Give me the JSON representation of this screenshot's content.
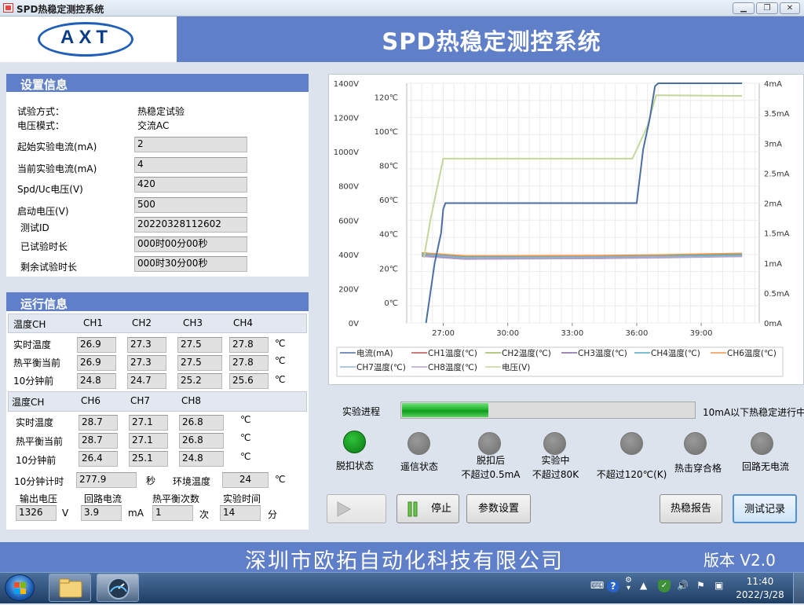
{
  "window": {
    "title": "SPD热稳定测控系统"
  },
  "header": {
    "logo_text": "AXT",
    "system_title": "SPD热稳定测控系统"
  },
  "settings": {
    "heading": "设置信息",
    "test_method_label": "试验方式：",
    "test_method_value": "热稳定试验",
    "voltage_mode_label": "电压模式：",
    "voltage_mode_value": "交流AC",
    "fields": [
      {
        "label": "起始实验电流(mA)",
        "value": "2"
      },
      {
        "label": "当前实验电流(mA)",
        "value": "4"
      },
      {
        "label": "Spd/Uc电压(V)",
        "value": "420"
      },
      {
        "label": "启动电压(V)",
        "value": "500"
      },
      {
        "label": "测试ID",
        "value": "20220328112602"
      },
      {
        "label": "已试验时长",
        "value": "000时00分00秒"
      },
      {
        "label": "剩余试验时长",
        "value": "000时30分00秒"
      }
    ]
  },
  "run": {
    "heading": "运行信息",
    "grp1": {
      "head": "温度CH",
      "cols": [
        "CH1",
        "CH2",
        "CH3",
        "CH4"
      ],
      "rows": [
        {
          "label": "实时温度",
          "vals": [
            "26.9",
            "27.3",
            "27.5",
            "27.8"
          ],
          "unit": "℃"
        },
        {
          "label": "热平衡当前",
          "vals": [
            "26.9",
            "27.3",
            "27.5",
            "27.8"
          ],
          "unit": "℃"
        },
        {
          "label": "10分钟前",
          "vals": [
            "24.8",
            "24.7",
            "25.2",
            "25.6"
          ],
          "unit": "℃"
        }
      ]
    },
    "grp2": {
      "head": "温度CH",
      "cols": [
        "CH6",
        "CH7",
        "CH8"
      ],
      "rows": [
        {
          "label": "实时温度",
          "vals": [
            "28.7",
            "27.1",
            "26.8"
          ],
          "unit": "℃"
        },
        {
          "label": "热平衡当前",
          "vals": [
            "28.7",
            "27.1",
            "26.8"
          ],
          "unit": "℃"
        },
        {
          "label": "10分钟前",
          "vals": [
            "26.4",
            "25.1",
            "24.8"
          ],
          "unit": "℃"
        }
      ]
    },
    "timer_label": "10分钟计时",
    "timer_value": "277.9",
    "timer_unit": "秒",
    "env_label": "环境温度",
    "env_value": "24",
    "env_unit": "℃",
    "bottom": [
      {
        "label": "输出电压",
        "value": "1326",
        "unit": "V"
      },
      {
        "label": "回路电流",
        "value": "3.9",
        "unit": "mA"
      },
      {
        "label": "热平衡次数",
        "value": "1",
        "unit": "次"
      },
      {
        "label": "实验时间",
        "value": "14",
        "unit": "分"
      }
    ]
  },
  "chart_data": {
    "type": "line",
    "x_ticks": [
      "27:00",
      "30:00",
      "33:00",
      "36:00",
      "39:00"
    ],
    "x_range_min": [
      25.3,
      41.7
    ],
    "y_left_voltage_ticks": [
      "1400V",
      "1200V",
      "1000V",
      "800V",
      "600V",
      "400V",
      "200V",
      "0V"
    ],
    "y_left_temp_ticks": [
      "120℃",
      "100℃",
      "80℃",
      "60℃",
      "40℃",
      "20℃",
      "0℃"
    ],
    "y_right_current_ticks": [
      "4mA",
      "3.5mA",
      "3mA",
      "2.5mA",
      "2mA",
      "1.5mA",
      "1mA",
      "0.5mA",
      "0mA"
    ],
    "ylim_voltage": [
      0,
      1400
    ],
    "ylim_current": [
      0,
      4.0
    ],
    "ylim_temp": [
      -12,
      128
    ],
    "grid": true,
    "legend_position": "bottom",
    "series": [
      {
        "name": "电流(mA)",
        "axis": "current",
        "color": "#4a6fa5",
        "points": [
          [
            26.2,
            0.0
          ],
          [
            26.4,
            0.5
          ],
          [
            26.6,
            1.0
          ],
          [
            26.9,
            1.5
          ],
          [
            27.0,
            1.9
          ],
          [
            27.1,
            2.0
          ],
          [
            36.0,
            2.0
          ],
          [
            36.3,
            2.9
          ],
          [
            36.6,
            3.4
          ],
          [
            36.85,
            3.95
          ],
          [
            37.0,
            4.0
          ],
          [
            40.9,
            4.0
          ]
        ]
      },
      {
        "name": "CH1温度(℃)",
        "axis": "temp",
        "color": "#c0504d",
        "points": [
          [
            26.0,
            27.5
          ],
          [
            28.0,
            25.6
          ],
          [
            31.0,
            25.8
          ],
          [
            34.0,
            26.0
          ],
          [
            37.0,
            26.4
          ],
          [
            40.9,
            27.0
          ]
        ]
      },
      {
        "name": "CH2温度(℃)",
        "axis": "temp",
        "color": "#9bbb59",
        "points": [
          [
            26.0,
            28.0
          ],
          [
            28.0,
            26.5
          ],
          [
            31.0,
            26.6
          ],
          [
            34.0,
            26.7
          ],
          [
            37.0,
            27.0
          ],
          [
            40.9,
            27.5
          ]
        ]
      },
      {
        "name": "CH3温度(℃)",
        "axis": "temp",
        "color": "#8064a2",
        "points": [
          [
            26.0,
            27.0
          ],
          [
            28.0,
            25.5
          ],
          [
            31.0,
            25.7
          ],
          [
            34.0,
            25.9
          ],
          [
            37.0,
            26.3
          ],
          [
            40.9,
            26.9
          ]
        ]
      },
      {
        "name": "CH4温度(℃)",
        "axis": "temp",
        "color": "#4bacc6",
        "points": [
          [
            26.0,
            28.5
          ],
          [
            28.0,
            26.8
          ],
          [
            31.0,
            27.0
          ],
          [
            34.0,
            27.2
          ],
          [
            37.0,
            27.5
          ],
          [
            40.9,
            28.0
          ]
        ]
      },
      {
        "name": "CH6温度(℃)",
        "axis": "temp",
        "color": "#f79646",
        "points": [
          [
            26.0,
            29.0
          ],
          [
            28.0,
            27.2
          ],
          [
            31.0,
            27.3
          ],
          [
            34.0,
            27.4
          ],
          [
            37.0,
            27.8
          ],
          [
            40.9,
            28.7
          ]
        ]
      },
      {
        "name": "CH7温度(℃)",
        "axis": "temp",
        "color": "#95b3d7",
        "points": [
          [
            26.0,
            27.8
          ],
          [
            28.0,
            26.0
          ],
          [
            31.0,
            26.2
          ],
          [
            34.0,
            26.4
          ],
          [
            37.0,
            26.7
          ],
          [
            40.9,
            27.1
          ]
        ]
      },
      {
        "name": "CH8温度(℃)",
        "axis": "temp",
        "color": "#b7a3c8",
        "points": [
          [
            26.0,
            26.9
          ],
          [
            28.0,
            25.2
          ],
          [
            31.0,
            25.4
          ],
          [
            34.0,
            25.6
          ],
          [
            37.0,
            26.0
          ],
          [
            40.9,
            26.8
          ]
        ]
      },
      {
        "name": "电压(V)",
        "axis": "voltage",
        "color": "#c4d79b",
        "points": [
          [
            26.1,
            380
          ],
          [
            26.4,
            600
          ],
          [
            26.9,
            900
          ],
          [
            27.0,
            960
          ],
          [
            35.8,
            960
          ],
          [
            36.5,
            1150
          ],
          [
            36.9,
            1330
          ],
          [
            37.1,
            1330
          ],
          [
            40.9,
            1326
          ]
        ]
      }
    ]
  },
  "progress": {
    "label": "实验进程",
    "fraction": 0.295,
    "status": "10mA以下热稳定进行中"
  },
  "indicators": [
    {
      "label": "脱扣状态",
      "on": true
    },
    {
      "label": "遥信状态",
      "on": false
    },
    {
      "label": "脱扣后\n不超过0.5mA",
      "on": false
    },
    {
      "label": "实验中\n不超过80K",
      "on": false
    },
    {
      "label": "不超过120℃(K)",
      "on": false
    },
    {
      "label": "热击穿合格",
      "on": false
    },
    {
      "label": "回路无电流",
      "on": false
    }
  ],
  "buttons": {
    "stop": "停止",
    "params": "参数设置",
    "report": "热稳报告",
    "records": "测试记录"
  },
  "footer": {
    "company": "深圳市欧拓自动化科技有限公司",
    "version": "版本 V2.0"
  },
  "taskbar": {
    "time": "11:40",
    "date": "2022/3/28"
  }
}
